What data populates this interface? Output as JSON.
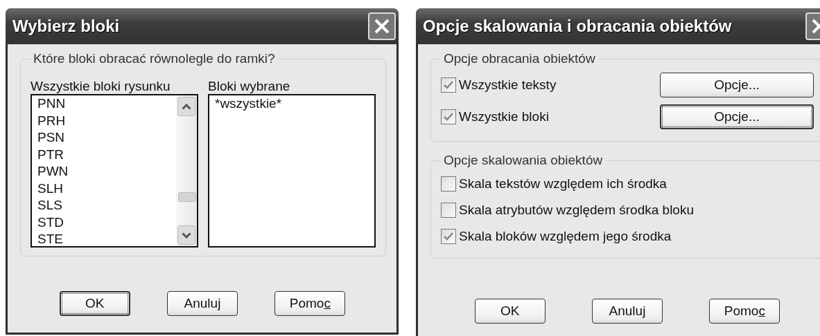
{
  "dialogs": [
    {
      "kind": "list_picker",
      "title": "Wybierz bloki",
      "group": {
        "label": "Które bloki obracać równolegle do ramki?"
      },
      "available": {
        "label": "Wszystkie bloki rysunku",
        "items": [
          "PNN",
          "PRH",
          "PSN",
          "PTR",
          "PWN",
          "SLH",
          "SLS",
          "STD",
          "STE"
        ]
      },
      "chosen": {
        "label": "Bloki wybrane",
        "items": [
          "*wszystkie*"
        ]
      },
      "buttons": [
        {
          "label": "OK",
          "focused": true
        },
        {
          "label": "Anuluj",
          "focused": false
        },
        {
          "label": "Pomoc",
          "focused": false,
          "last_letter_underlined": true
        }
      ]
    },
    {
      "kind": "options",
      "title": "Opcje skalowania i obracania obiektów",
      "groups": [
        {
          "label": "Opcje obracania obiektów",
          "rows": [
            {
              "label": "Wszystkie teksty",
              "checked": true,
              "button": {
                "label": "Opcje...",
                "focused": false
              }
            },
            {
              "label": "Wszystkie bloki",
              "checked": true,
              "button": {
                "label": "Opcje...",
                "focused": true
              }
            }
          ]
        },
        {
          "label": "Opcje skalowania obiektów",
          "rows": [
            {
              "label": "Skala tekstów względem ich środka",
              "checked": false
            },
            {
              "label": "Skala atrybutów względem środka bloku",
              "checked": false
            },
            {
              "label": "Skala bloków względem jego środka",
              "checked": true
            }
          ]
        }
      ],
      "buttons": [
        {
          "label": "OK",
          "focused": false
        },
        {
          "label": "Anuluj",
          "focused": false
        },
        {
          "label": "Pomoc",
          "focused": false,
          "last_letter_underlined": true
        }
      ]
    }
  ]
}
